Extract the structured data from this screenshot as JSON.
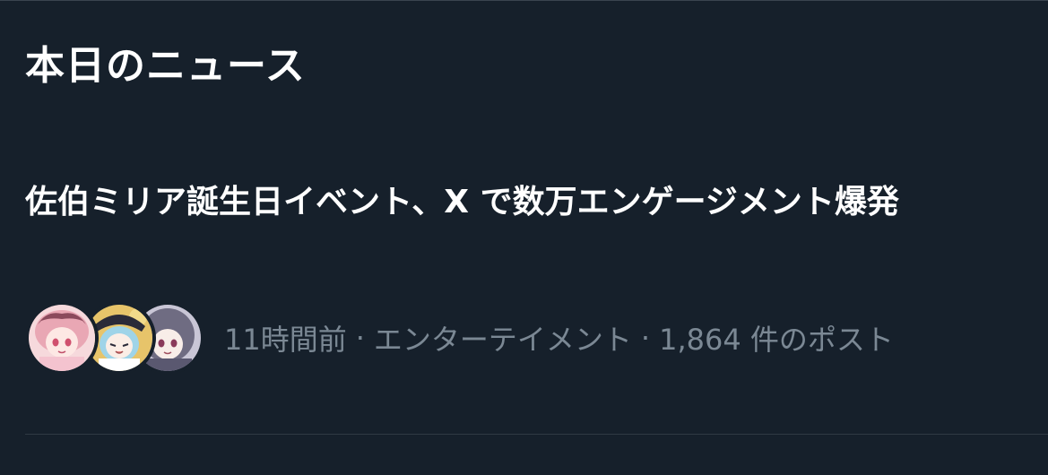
{
  "section": {
    "title": "本日のニュース"
  },
  "news": [
    {
      "headline": "佐伯ミリア誕生日イベント、X で数万エンゲージメント爆発",
      "time": "11時間前",
      "separator": "·",
      "category": "エンターテイメント",
      "post_count": "1,864 件のポスト",
      "avatars": [
        "pink-hair-character-avatar",
        "blue-hair-character-avatar",
        "gray-hair-character-avatar"
      ]
    }
  ],
  "colors": {
    "background": "#16202b",
    "text_primary": "#ffffff",
    "text_secondary": "#7b8894",
    "divider": "#2f3943"
  }
}
